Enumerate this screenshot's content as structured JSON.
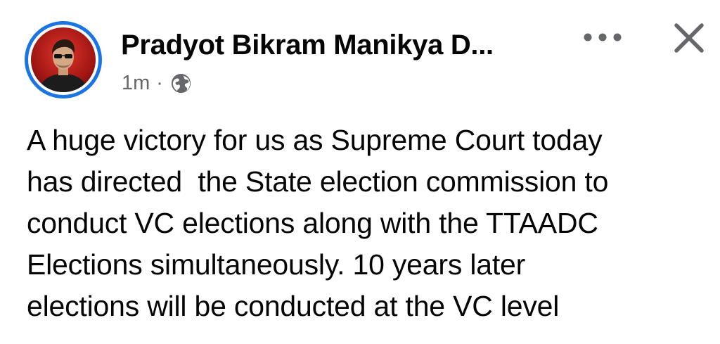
{
  "post": {
    "author_name": "Pradyot Bikram Manikya D...",
    "timestamp": "1m",
    "separator": "·",
    "privacy_icon": "globe-icon",
    "more_icon": "more-horizontal-icon",
    "close_icon": "close-icon",
    "text": "A huge victory for us as Supreme Court today\nhas directed  the State election commission to\nconduct VC elections along with the TTAADC\nElections simultaneously. 10 years later\nelections will be conducted at the VC level"
  },
  "colors": {
    "ring": "#1b74e4",
    "meta_text": "#65676b",
    "body_text": "#050505",
    "icon": "#65676b"
  }
}
